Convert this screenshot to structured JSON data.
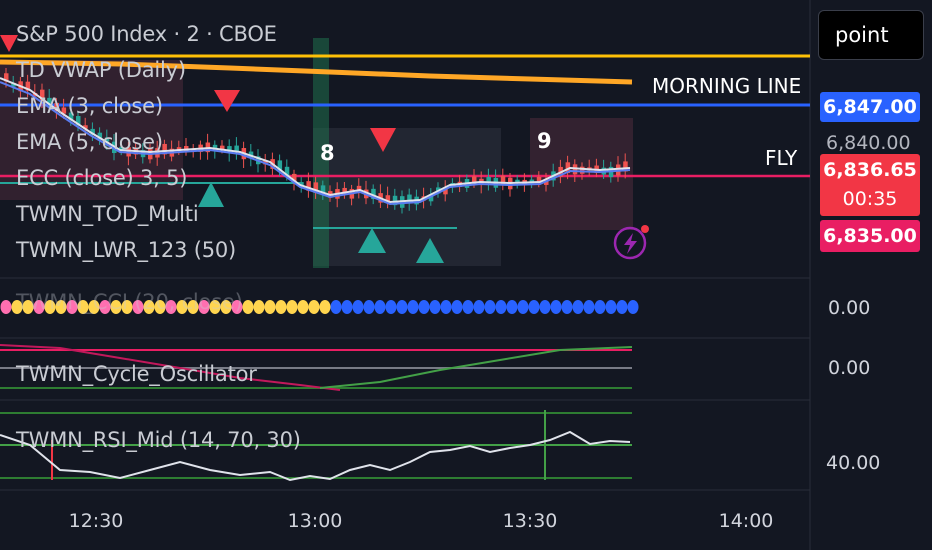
{
  "symbol_title": "S&P 500 Index · 2 · CBOE",
  "indicators": [
    "TD VWAP (Daily)",
    "EMA (3, close)",
    "EMA (5, close)",
    "ECC (close) 3, 5)",
    "TWMN_TOD_Multi",
    "TWMN_LWR_123 (50)"
  ],
  "pane_labels": {
    "cycle": "TWMN_Cycle_Oscillator",
    "rsi": "TWMN_RSI_Mid (14, 70, 30)",
    "dots": "TWMN_CCI (20, close)"
  },
  "price_scale": {
    "current_price": "6,847.00",
    "level_upper": "6,840.00",
    "last_price": "6,836.65",
    "countdown": "00:35",
    "level_lower": "6,835.00",
    "dots_pane_value": "0.00",
    "cycle_pane_value": "0.00",
    "rsi_pane_value": "40.00"
  },
  "chart_labels": {
    "morning_line": "MORNING LINE",
    "fly": "FLY",
    "count_8": "8",
    "count_9": "9"
  },
  "time_axis": [
    "12:30",
    "13:00",
    "13:30",
    "14:00"
  ],
  "toolbar": {
    "point_button": "point"
  },
  "colors": {
    "background": "#131722",
    "up_candle": "#26a69a",
    "down_candle": "#ef5350",
    "vwap": "#ffa726",
    "morning_line": "#2962ff",
    "ema": "#ffffff",
    "ecc_line": "#e91e63",
    "blue_label": "#2962ff",
    "red_label": "#f23645",
    "pink_label": "#e91e63"
  }
}
